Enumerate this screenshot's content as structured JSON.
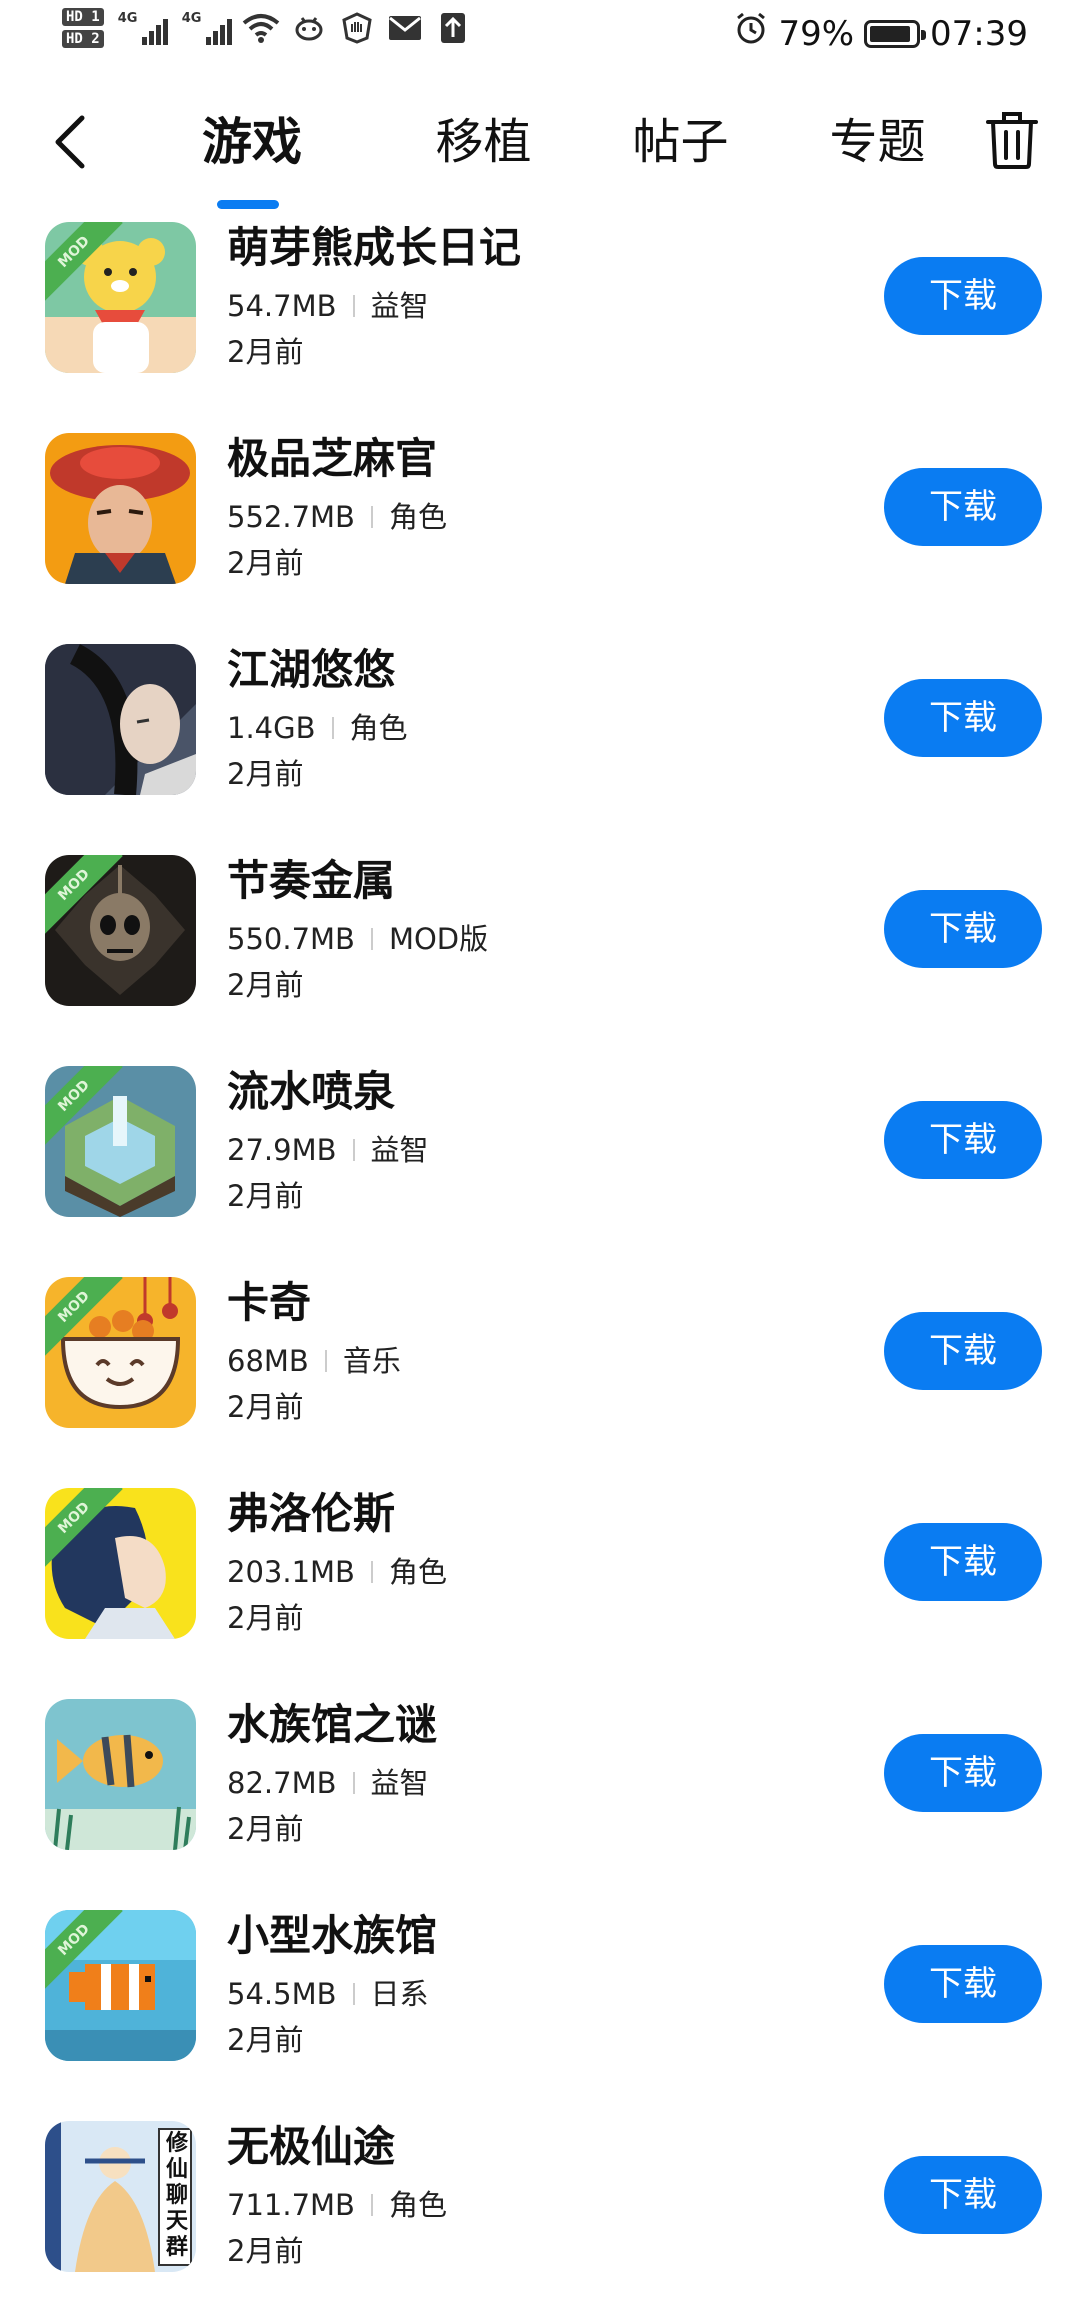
{
  "status_bar": {
    "sim1": "HD 1",
    "sim2": "HD 2",
    "net1": "4G",
    "net2": "4G",
    "battery_percent": "79%",
    "time": "07:39"
  },
  "nav": {
    "tabs": [
      "游戏",
      "移植",
      "帖子",
      "专题"
    ],
    "active_tab": 0
  },
  "accent_color": "#0a7cf2",
  "download_label": "下载",
  "apps": [
    {
      "name": "萌芽熊成长日记",
      "size": "54.7MB",
      "category": "益智",
      "time": "2月前",
      "mod": "MOD",
      "icon": "bear-icon"
    },
    {
      "name": "极品芝麻官",
      "size": "552.7MB",
      "category": "角色",
      "time": "2月前",
      "mod": "",
      "icon": "official-icon"
    },
    {
      "name": "江湖悠悠",
      "size": "1.4GB",
      "category": "角色",
      "time": "2月前",
      "mod": "",
      "icon": "swordsman-icon"
    },
    {
      "name": "节奏金属",
      "size": "550.7MB",
      "category": "MOD版",
      "time": "2月前",
      "mod": "MOD",
      "icon": "skull-icon"
    },
    {
      "name": "流水喷泉",
      "size": "27.9MB",
      "category": "益智",
      "time": "2月前",
      "mod": "MOD",
      "icon": "fountain-icon"
    },
    {
      "name": "卡奇",
      "size": "68MB",
      "category": "音乐",
      "time": "2月前",
      "mod": "MOD",
      "icon": "bowl-icon"
    },
    {
      "name": "弗洛伦斯",
      "size": "203.1MB",
      "category": "角色",
      "time": "2月前",
      "mod": "MOD",
      "icon": "florence-icon"
    },
    {
      "name": "水族馆之谜",
      "size": "82.7MB",
      "category": "益智",
      "time": "2月前",
      "mod": "",
      "icon": "fish-icon"
    },
    {
      "name": "小型水族馆",
      "size": "54.5MB",
      "category": "日系",
      "time": "2月前",
      "mod": "MOD",
      "icon": "clownfish-icon"
    },
    {
      "name": "无极仙途",
      "size": "711.7MB",
      "category": "角色",
      "time": "2月前",
      "mod": "",
      "icon": "immortal-icon"
    }
  ],
  "immortal_icon_text": "修仙聊天群"
}
